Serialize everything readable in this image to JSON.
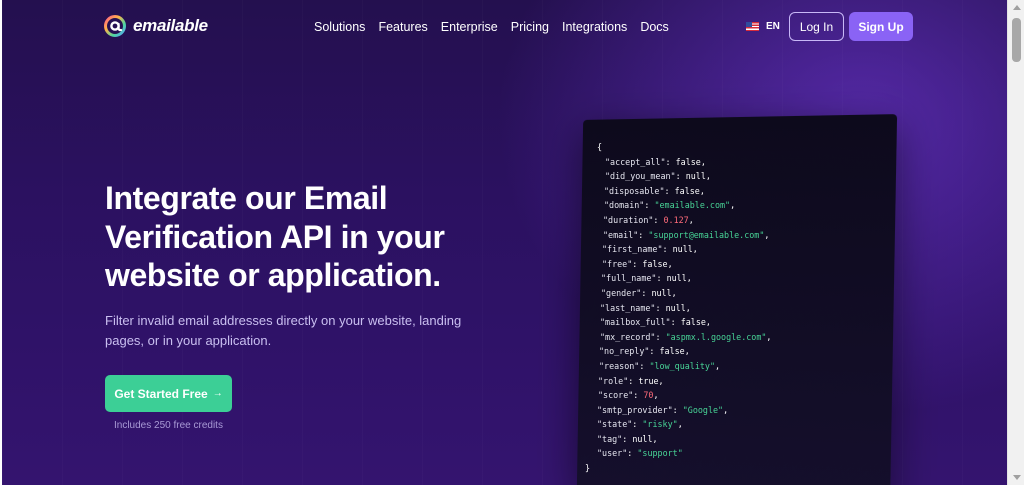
{
  "brand": {
    "name": "emailable"
  },
  "nav": {
    "items": [
      "Solutions",
      "Features",
      "Enterprise",
      "Pricing",
      "Integrations",
      "Docs"
    ]
  },
  "lang": {
    "code": "EN"
  },
  "header": {
    "login_label": "Log In",
    "signup_label": "Sign Up"
  },
  "hero": {
    "headline": "Integrate our Email Verification API in your website or application.",
    "subtext": "Filter invalid email addresses directly on your website, landing pages, or in your application.",
    "cta_label": "Get Started Free",
    "cta_arrow": "→",
    "credits_note": "Includes 250 free credits"
  },
  "code": {
    "open": "{",
    "close": "}",
    "fields": [
      {
        "key": "\"accept_all\"",
        "value": "false",
        "type": "kw"
      },
      {
        "key": "\"did_you_mean\"",
        "value": "null",
        "type": "kw"
      },
      {
        "key": "\"disposable\"",
        "value": "false",
        "type": "kw"
      },
      {
        "key": "\"domain\"",
        "value": "\"emailable.com\"",
        "type": "str"
      },
      {
        "key": "\"duration\"",
        "value": "0.127",
        "type": "num"
      },
      {
        "key": "\"email\"",
        "value": "\"support@emailable.com\"",
        "type": "str"
      },
      {
        "key": "\"first_name\"",
        "value": "null",
        "type": "kw"
      },
      {
        "key": "\"free\"",
        "value": "false",
        "type": "kw"
      },
      {
        "key": "\"full_name\"",
        "value": "null",
        "type": "kw"
      },
      {
        "key": "\"gender\"",
        "value": "null",
        "type": "kw"
      },
      {
        "key": "\"last_name\"",
        "value": "null",
        "type": "kw"
      },
      {
        "key": "\"mailbox_full\"",
        "value": "false",
        "type": "kw"
      },
      {
        "key": "\"mx_record\"",
        "value": "\"aspmx.l.google.com\"",
        "type": "str"
      },
      {
        "key": "\"no_reply\"",
        "value": "false",
        "type": "kw"
      },
      {
        "key": "\"reason\"",
        "value": "\"low_quality\"",
        "type": "str"
      },
      {
        "key": "\"role\"",
        "value": "true",
        "type": "kw"
      },
      {
        "key": "\"score\"",
        "value": "70",
        "type": "num"
      },
      {
        "key": "\"smtp_provider\"",
        "value": "\"Google\"",
        "type": "str"
      },
      {
        "key": "\"state\"",
        "value": "\"risky\"",
        "type": "str"
      },
      {
        "key": "\"tag\"",
        "value": "null",
        "type": "kw"
      },
      {
        "key": "\"user\"",
        "value": "\"support\"",
        "type": "str"
      }
    ]
  },
  "colors": {
    "background": "#2b1160",
    "accent": "#8a63f5",
    "cta": "#3ccf96",
    "code_string": "#48d597",
    "code_number": "#ff6b7a"
  }
}
